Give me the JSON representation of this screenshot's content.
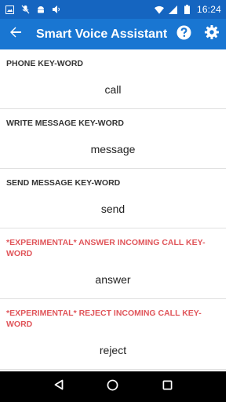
{
  "status_bar": {
    "time": "16:24",
    "left_icons": [
      "image-icon",
      "mute-icon",
      "android-icon",
      "volume-icon"
    ],
    "right_icons": [
      "wifi-icon",
      "signal-icon",
      "battery-icon"
    ]
  },
  "app_bar": {
    "title": "Smart Voice Assistant",
    "back_icon": "arrow-back-icon",
    "help_icon": "help-icon",
    "settings_icon": "gear-icon",
    "color": "#1976d2"
  },
  "settings": [
    {
      "label": "PHONE KEY-WORD",
      "value": "call",
      "experimental": false
    },
    {
      "label": "WRITE MESSAGE KEY-WORD",
      "value": "message",
      "experimental": false
    },
    {
      "label": "SEND MESSAGE KEY-WORD",
      "value": "send",
      "experimental": false
    },
    {
      "label": "*EXPERIMENTAL* ANSWER INCOMING CALL KEY-WORD",
      "value": "answer",
      "experimental": true
    },
    {
      "label": "*EXPERIMENTAL* REJECT INCOMING CALL KEY-WORD",
      "value": "reject",
      "experimental": true
    }
  ],
  "nav_bar": {
    "icons": [
      "back-triangle-icon",
      "home-circle-icon",
      "recents-square-icon"
    ]
  },
  "colors": {
    "status_bar": "#1565c0",
    "experimental_label": "#e0555a"
  }
}
